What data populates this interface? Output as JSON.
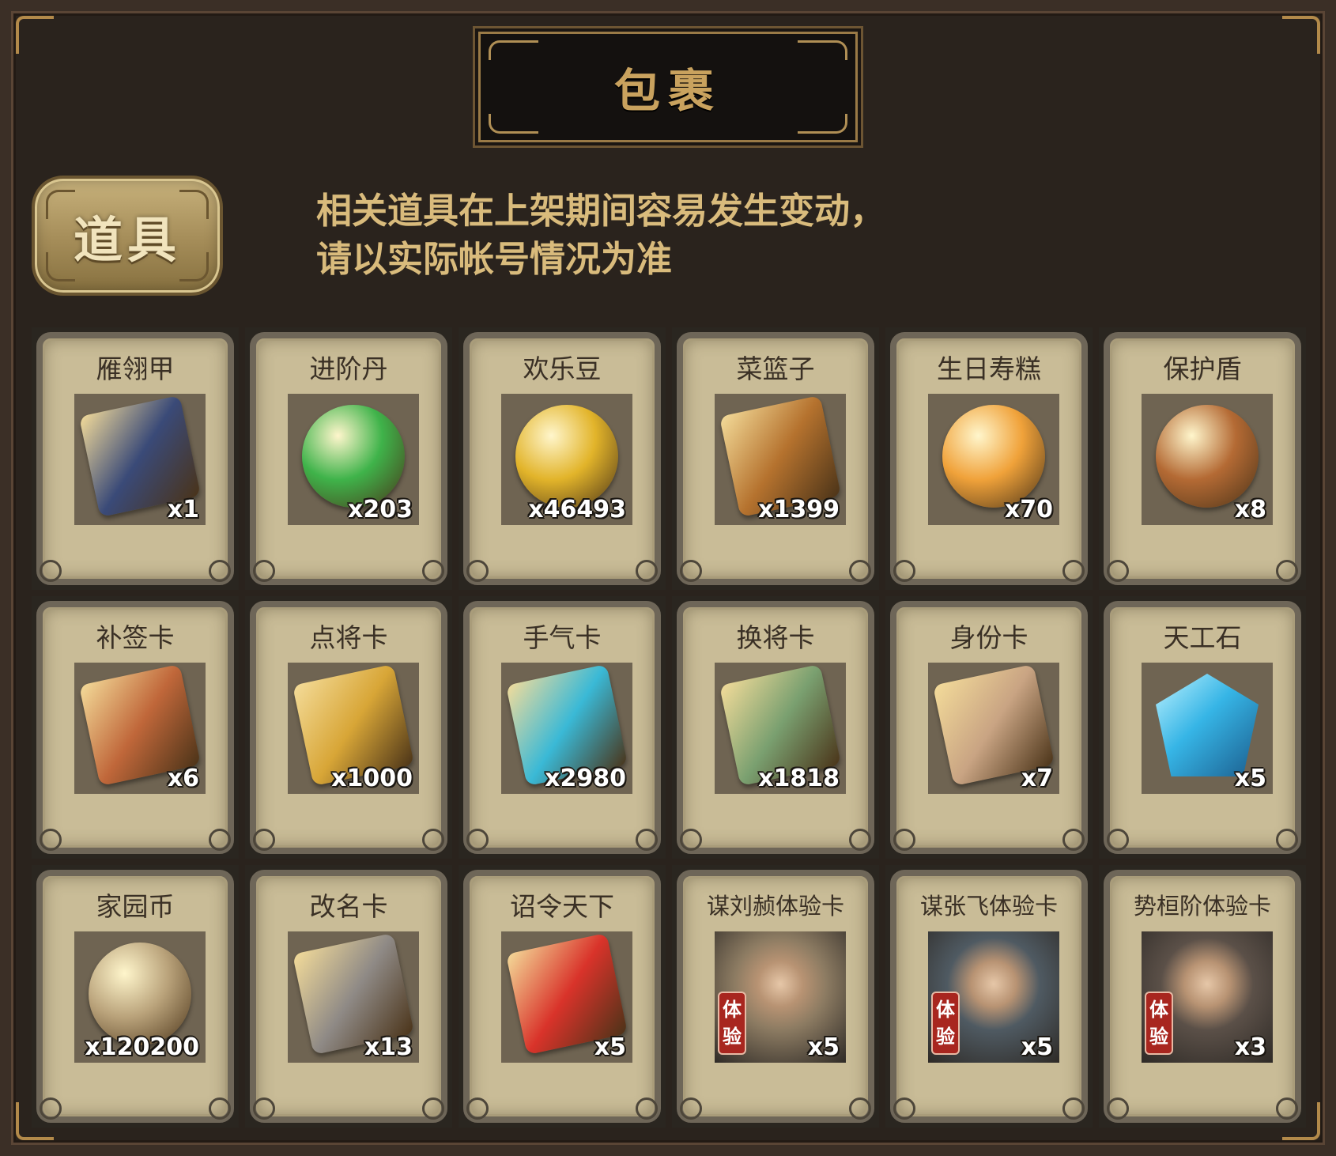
{
  "title": "包裹",
  "tab": {
    "label": "道具"
  },
  "notice": {
    "line1": "相关道具在上架期间容易发生变动，",
    "line2": "请以实际帐号情况为准"
  },
  "items": [
    {
      "name": "雁翎甲",
      "qty": "x1",
      "icon": "armor-helmet-icon",
      "color": "#3a4a78"
    },
    {
      "name": "进阶丹",
      "qty": "x203",
      "icon": "green-orb-icon",
      "color": "#3fb34a"
    },
    {
      "name": "欢乐豆",
      "qty": "x46493",
      "icon": "gold-beans-icon",
      "color": "#e2b42a"
    },
    {
      "name": "菜篮子",
      "qty": "x1399",
      "icon": "flower-basket-icon",
      "color": "#b5722e"
    },
    {
      "name": "生日寿糕",
      "qty": "x70",
      "icon": "birthday-cake-icon",
      "color": "#f0a23a"
    },
    {
      "name": "保护盾",
      "qty": "x8",
      "icon": "round-shield-icon",
      "color": "#b46a34"
    },
    {
      "name": "补签卡",
      "qty": "x6",
      "icon": "bronze-token-icon",
      "color": "#c0673a"
    },
    {
      "name": "点将卡",
      "qty": "x1000",
      "icon": "gold-command-token-icon",
      "color": "#d8a637"
    },
    {
      "name": "手气卡",
      "qty": "x2980",
      "icon": "luck-card-icon",
      "color": "#3ab9d6"
    },
    {
      "name": "换将卡",
      "qty": "x1818",
      "icon": "swap-general-token-icon",
      "color": "#7aa070"
    },
    {
      "name": "身份卡",
      "qty": "x7",
      "icon": "opera-mask-card-icon",
      "color": "#c9a483"
    },
    {
      "name": "天工石",
      "qty": "x5",
      "icon": "blue-crystal-icon",
      "color": "#36b5e6"
    },
    {
      "name": "家园币",
      "qty": "x120200",
      "icon": "home-coin-icon",
      "color": "#b9a27a"
    },
    {
      "name": "改名卡",
      "qty": "x13",
      "icon": "rename-tag-icon",
      "color": "#8f8a86"
    },
    {
      "name": "诏令天下",
      "qty": "x5",
      "icon": "imperial-scroll-icon",
      "color": "#d9332a"
    },
    {
      "name": "谋刘赪体验卡",
      "qty": "x5",
      "icon": "general-portrait-female-icon",
      "color": "#8c7b62",
      "trial": "体验"
    },
    {
      "name": "谋张飞体验卡",
      "qty": "x5",
      "icon": "general-portrait-zhangfei-icon",
      "color": "#4f5a62",
      "trial": "体验"
    },
    {
      "name": "势桓阶体验卡",
      "qty": "x3",
      "icon": "general-portrait-male-icon",
      "color": "#5b5048",
      "trial": "体验"
    }
  ]
}
